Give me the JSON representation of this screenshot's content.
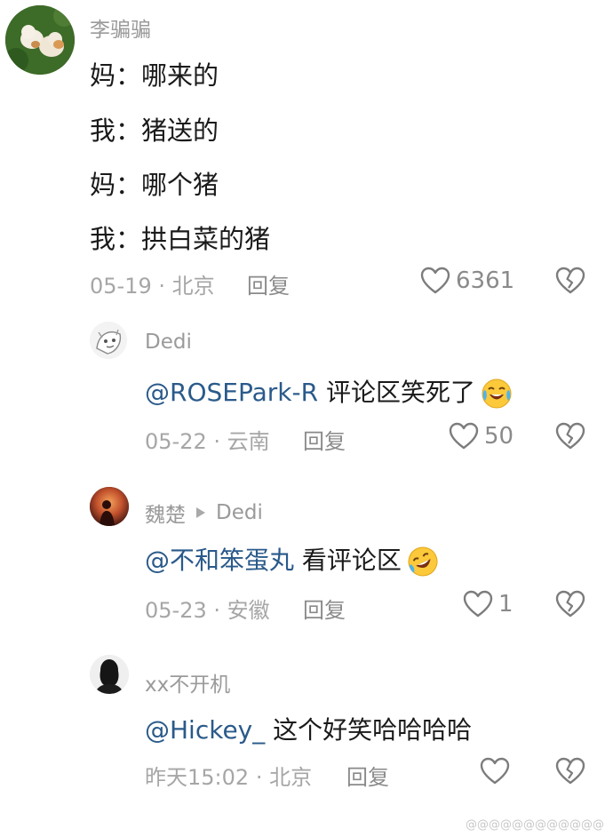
{
  "main_comment": {
    "username": "李骗骗",
    "lines": [
      "妈：哪来的",
      "我：猪送的",
      "妈：哪个猪",
      "我：拱白菜的猪"
    ],
    "date": "05-19",
    "location": "北京",
    "reply_label": "回复",
    "likes": "6361"
  },
  "replies": [
    {
      "username": "Dedi",
      "mention": "@ROSEPark-R",
      "text": "评论区笑死了",
      "date": "05-22",
      "location": "云南",
      "reply_label": "回复",
      "likes": "50"
    },
    {
      "username": "魏楚",
      "reply_to": "Dedi",
      "mention": "@不和笨蛋丸",
      "text": "看评论区",
      "date": "05-23",
      "location": "安徽",
      "reply_label": "回复",
      "likes": "1"
    },
    {
      "username": "xx不开机",
      "mention": "@Hickey_",
      "text": "这个好笑哈哈哈哈",
      "date": "昨天15:02",
      "location": "北京",
      "reply_label": "回复",
      "likes": ""
    }
  ],
  "separator": "·",
  "icons": {
    "like": "heart-outline-icon",
    "dislike": "broken-heart-icon",
    "reply_arrow": "triangle-right-icon"
  },
  "watermark": "@@@@@@@@@@@@"
}
